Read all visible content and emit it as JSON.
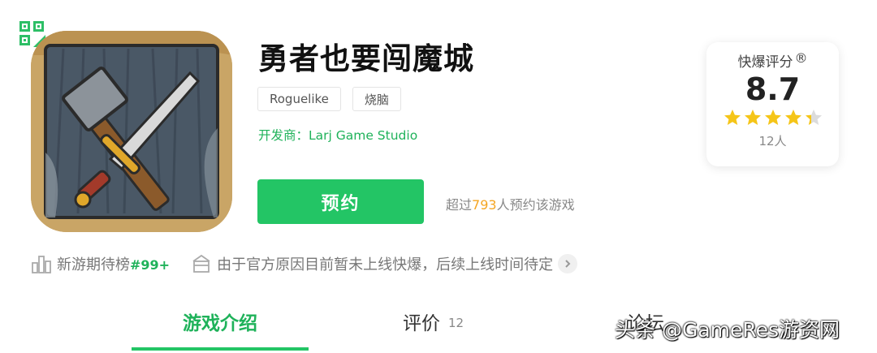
{
  "game": {
    "title": "勇者也要闯魔城",
    "tags": [
      "Roguelike",
      "烧脑"
    ],
    "developer": "开发商：Larj Game Studio"
  },
  "reserve": {
    "button_label": "预约",
    "prefix": "超过",
    "count": "793",
    "suffix": "人预约该游戏"
  },
  "score": {
    "label": "快爆评分",
    "registered": "®",
    "value": "8.7",
    "stars": 4.35,
    "count": "12人",
    "star_color": "#f5c518"
  },
  "meta": {
    "rank_label": "新游期待榜",
    "rank_value": "#99+",
    "notice": "由于官方原因目前暂未上线快爆，后续上线时间待定"
  },
  "tabs": [
    {
      "label": "游戏介绍",
      "active": true
    },
    {
      "label": "评价",
      "count": "12"
    },
    {
      "label": "论坛"
    }
  ],
  "watermark": "头条 @GameRes游资网",
  "colors": {
    "accent": "#23c565",
    "highlight": "#f5a623"
  }
}
